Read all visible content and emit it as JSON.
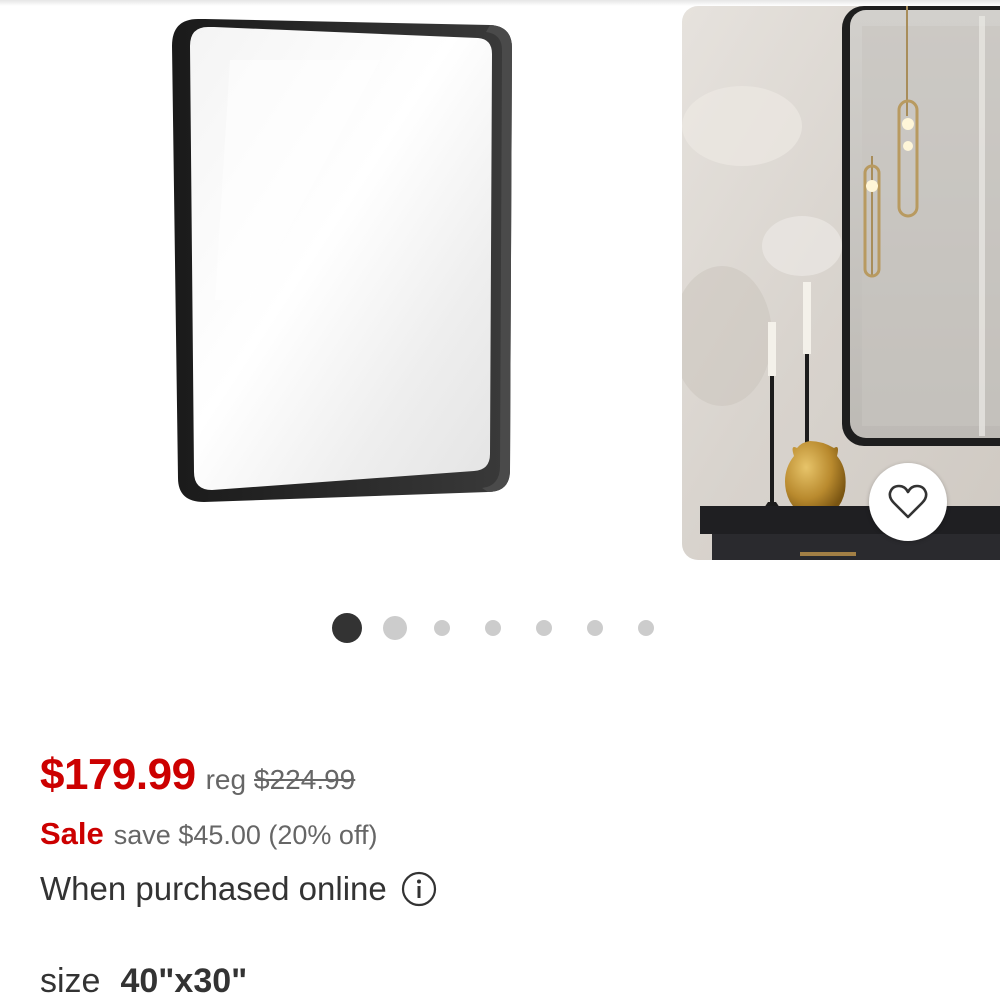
{
  "product": {
    "images": [
      {
        "icon": "mirror-product-image"
      },
      {
        "icon": "mirror-lifestyle-image"
      }
    ],
    "carousel": {
      "total_images": 7,
      "active_index": 0
    }
  },
  "pricing": {
    "current_price": "$179.99",
    "reg_label": "reg",
    "reg_price": "$224.99",
    "sale_label": "Sale",
    "savings_text": "save $45.00 (20% off)",
    "online_note": "When purchased online"
  },
  "variant": {
    "size_label": "size",
    "size_value": "40\"x30\""
  },
  "colors": {
    "sale_red": "#cc0000",
    "text_dark": "#333333",
    "text_muted": "#666666",
    "dot_active": "#333333",
    "dot_inactive": "#cccccc"
  }
}
